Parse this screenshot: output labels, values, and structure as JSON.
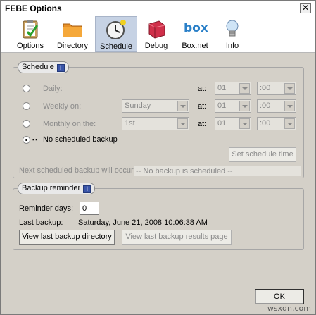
{
  "window": {
    "title": "FEBE Options",
    "close_glyph": "✕"
  },
  "toolbar": {
    "items": [
      {
        "label": "Options",
        "icon": "clipboard-check-icon"
      },
      {
        "label": "Directory",
        "icon": "folder-icon"
      },
      {
        "label": "Schedule",
        "icon": "clock-icon",
        "active": true
      },
      {
        "label": "Debug",
        "icon": "debug-box-icon"
      },
      {
        "label": "Box.net",
        "icon": "box-logo-icon"
      },
      {
        "label": "Info",
        "icon": "lightbulb-icon"
      }
    ],
    "box_logo_text": "box"
  },
  "schedule": {
    "group_label": "Schedule",
    "info_glyph": "i",
    "daily_label": "Daily:",
    "weekly_label": "Weekly on:",
    "monthly_label": "Monthly on the:",
    "none_label": "No scheduled backup",
    "at_label": "at:",
    "weekday_value": "Sunday",
    "monthday_value": "1st",
    "hour_value": "01",
    "minute_value": ":00",
    "set_time_button": "Set schedule time",
    "next_label": "Next scheduled backup will occur:",
    "next_value": "-- No backup is scheduled  --",
    "radio_indicator": "▪▪"
  },
  "reminder": {
    "group_label": "Backup reminder",
    "info_glyph": "i",
    "days_label": "Reminder days:",
    "days_value": "0",
    "last_label": "Last backup:",
    "last_value": "Saturday, June 21, 2008 10:06:38 AM",
    "view_dir_button": "View last backup directory",
    "view_results_button": "View last backup results page"
  },
  "footer": {
    "ok_button": "OK",
    "watermark": "wsxdn.com"
  },
  "colors": {
    "active_tab": "#c6d2e4",
    "dialog_bg": "#d4d0c8",
    "box_blue": "#2a80c8"
  }
}
